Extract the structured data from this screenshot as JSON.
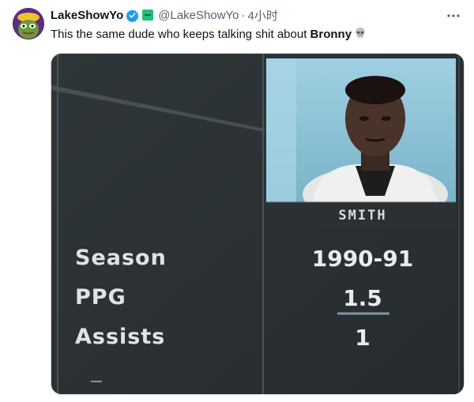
{
  "tweet": {
    "display_name": "LakeShowYo",
    "handle": "@LakeShowYo",
    "separator": "·",
    "time": "4小时",
    "text_prefix": "This the same dude who keeps talking shit about ",
    "text_bold": "Bronny",
    "icons": {
      "avatar": "pepe-avatar-icon",
      "verified": "verified-badge-icon",
      "affiliate": "green-badge-icon",
      "more": "more-options-icon",
      "emoji": "skull-emoji-icon"
    },
    "colors": {
      "verified": "#1d9bf0",
      "affiliate": "#1fbf7a",
      "muted": "#536471"
    }
  },
  "stat_card": {
    "player_name": "SMITH",
    "rows": [
      {
        "label": "Season",
        "value": "1990-91"
      },
      {
        "label": "PPG",
        "value": "1.5"
      },
      {
        "label": "Assists",
        "value": "1"
      }
    ],
    "colors": {
      "background": "#2b3134",
      "photo_accent": "#8ec3d6",
      "text": "#e8ecee"
    }
  }
}
